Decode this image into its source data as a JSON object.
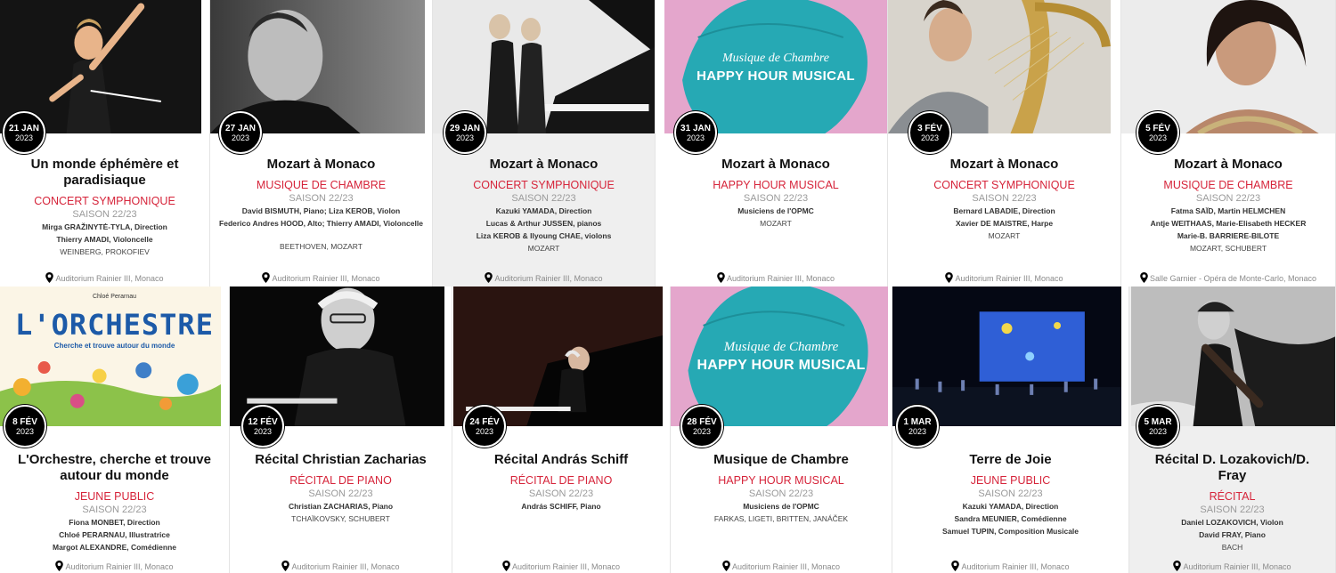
{
  "events": [
    {
      "id": "e1",
      "date": "21 JAN",
      "year": "2023",
      "title": "Un monde éphémère et paradisiaque",
      "category": "CONCERT SYMPHONIQUE",
      "season": "SAISON 22/23",
      "artists": [
        "Mirga GRAŽINYTĖ-TYLA, Direction",
        "Thierry AMADI, Violoncelle"
      ],
      "program": "WEINBERG, PROKOFIEV",
      "venue": "Auditorium Rainier III, Monaco",
      "image": "conductor-photo"
    },
    {
      "id": "e2",
      "date": "27 JAN",
      "year": "2023",
      "title": "Mozart à Monaco",
      "category": "MUSIQUE DE CHAMBRE",
      "season": "SAISON 22/23",
      "artists": [
        "David BISMUTH, Piano; Liza KEROB, Violon",
        "Federico Andres HOOD, Alto; Thierry AMADI, Violoncelle"
      ],
      "program": "BEETHOVEN, MOZART",
      "venue": "Auditorium Rainier III, Monaco",
      "image": "musician-portrait"
    },
    {
      "id": "e3",
      "date": "29 JAN",
      "year": "2023",
      "title": "Mozart à Monaco",
      "category": "CONCERT SYMPHONIQUE",
      "season": "SAISON 22/23",
      "artists": [
        "Kazuki YAMADA, Direction",
        "Lucas & Arthur JUSSEN, pianos",
        "Liza KEROB & Ilyoung CHAE, violons"
      ],
      "program": "MOZART",
      "venue": "Auditorium Rainier III, Monaco",
      "image": "piano-duo-photo"
    },
    {
      "id": "e4",
      "date": "31 JAN",
      "year": "2023",
      "title": "Mozart à Monaco",
      "category": "HAPPY HOUR MUSICAL",
      "season": "SAISON 22/23",
      "artists": [
        "Musiciens de l'OPMC"
      ],
      "program": "MOZART",
      "venue": "Auditorium Rainier III, Monaco",
      "image": "happy-hour-poster",
      "poster_line1": "Musique de Chambre",
      "poster_line2": "HAPPY HOUR MUSICAL"
    },
    {
      "id": "e5",
      "date": "3 FÉV",
      "year": "2023",
      "title": "Mozart à Monaco",
      "category": "CONCERT SYMPHONIQUE",
      "season": "SAISON 22/23",
      "artists": [
        "Bernard LABADIE, Direction",
        "Xavier DE MAISTRE, Harpe"
      ],
      "program": "MOZART",
      "venue": "Auditorium Rainier III, Monaco",
      "image": "harpist-photo"
    },
    {
      "id": "e6",
      "date": "5 FÉV",
      "year": "2023",
      "title": "Mozart à Monaco",
      "category": "MUSIQUE DE CHAMBRE",
      "season": "SAISON 22/23",
      "artists": [
        "Fatma SAÏD, Martin HELMCHEN",
        "Antje WEITHAAS, Marie-Elisabeth HECKER",
        "Marie-B. BARRIERE-BILOTE"
      ],
      "program": "MOZART, SCHUBERT",
      "venue": "Salle Garnier - Opéra de Monte-Carlo, Monaco",
      "image": "singer-portrait"
    },
    {
      "id": "e7",
      "date": "8 FÉV",
      "year": "2023",
      "title": "L'Orchestre, cherche et trouve autour du monde",
      "category": "JEUNE PUBLIC",
      "season": "SAISON 22/23",
      "artists": [
        "Fiona MONBET, Direction",
        "Chloé PERARNAU, Illustratrice",
        "Margot ALEXANDRE, Comédienne"
      ],
      "program": "",
      "venue": "Auditorium Rainier III, Monaco",
      "image": "book-cover",
      "book_author": "Chloé Perarnau",
      "book_title": "L'ORCHESTRE",
      "book_subtitle": "Cherche et trouve autour du monde"
    },
    {
      "id": "e8",
      "date": "12 FÉV",
      "year": "2023",
      "title": "Récital Christian Zacharias",
      "category": "RÉCITAL DE PIANO",
      "season": "SAISON 22/23",
      "artists": [
        "Christian ZACHARIAS, Piano"
      ],
      "program": "TCHAÏKOVSKY, SCHUBERT",
      "venue": "Auditorium Rainier III, Monaco",
      "image": "pianist-portrait"
    },
    {
      "id": "e9",
      "date": "24 FÉV",
      "year": "2023",
      "title": "Récital András Schiff",
      "category": "RÉCITAL DE PIANO",
      "season": "SAISON 22/23",
      "artists": [
        "András SCHIFF, Piano"
      ],
      "program": "",
      "venue": "Auditorium Rainier III, Monaco",
      "image": "pianist-at-piano-photo"
    },
    {
      "id": "e10",
      "date": "28 FÉV",
      "year": "2023",
      "title": "Musique de Chambre",
      "category": "HAPPY HOUR MUSICAL",
      "season": "SAISON 22/23",
      "artists": [
        "Musiciens de l'OPMC"
      ],
      "program": "FARKAS, LIGETI, BRITTEN, JANÁČEK",
      "venue": "Auditorium Rainier III, Monaco",
      "image": "happy-hour-poster",
      "poster_line1": "Musique de Chambre",
      "poster_line2": "HAPPY HOUR MUSICAL"
    },
    {
      "id": "e11",
      "date": "1 MAR",
      "year": "2023",
      "title": "Terre de Joie",
      "category": "JEUNE PUBLIC",
      "season": "SAISON 22/23",
      "artists": [
        "Kazuki YAMADA, Direction",
        "Sandra MEUNIER, Comédienne",
        "Samuel TUPIN, Composition Musicale"
      ],
      "program": "",
      "venue": "Auditorium Rainier III, Monaco",
      "image": "orchestra-stage-photo"
    },
    {
      "id": "e12",
      "date": "5 MAR",
      "year": "2023",
      "title": "Récital D. Lozakovich/D. Fray",
      "category": "RÉCITAL",
      "season": "SAISON 22/23",
      "artists": [
        "Daniel LOZAKOVICH, Violon",
        "David FRAY, Piano"
      ],
      "program": "BACH",
      "venue": "Auditorium Rainier III, Monaco",
      "image": "violinist-photo"
    }
  ],
  "colors": {
    "category": "#d6243a",
    "badge": "#000000",
    "poster_pink": "#e4a6cc",
    "poster_teal": "#26a9b4"
  }
}
